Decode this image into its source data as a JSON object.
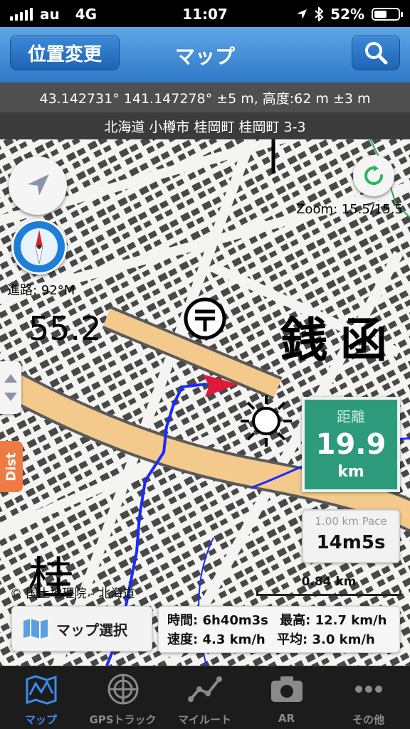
{
  "status_bar": {
    "carrier": "au",
    "network": "4G",
    "time": "11:07",
    "battery": "52%",
    "battery_level": 0.52,
    "icons": [
      "signal-icon",
      "location-arrow-icon",
      "bluetooth-icon",
      "battery-icon"
    ]
  },
  "nav": {
    "location_change_label": "位置変更",
    "title": "マップ",
    "search_icon": "search-icon"
  },
  "info": {
    "coordinates": "43.142731° 141.147278° ±5 m, 高度:62 m ±3 m",
    "address": "北海道 小樽市 桂岡町 桂岡町 3-3"
  },
  "map": {
    "zoom_text": "Zoom: 15.5/15.5",
    "heading_text": "進路: 92°M",
    "dist_tab_label": "Dist",
    "map_labels": {
      "elevation": "55.2",
      "place_name": "銭函",
      "place_name_2": "桂"
    },
    "distance": {
      "label": "距離",
      "value": "19.9",
      "unit": "km"
    },
    "pace": {
      "label": "1.00 km Pace",
      "value": "14m5s"
    },
    "scale_label": "0.84 km",
    "credit": "© 国土地理院 - 北海道",
    "map_select_label": "マップ選択",
    "stats": {
      "time": "時間: 6h40m3s",
      "max_speed": "最高: 12.7 km/h",
      "speed": "速度: 4.3 km/h",
      "average": "平均: 3.0 km/h"
    },
    "colors": {
      "road": "#f3c98c",
      "track": "#1a2bff",
      "heading_arrow": "#e0183a",
      "distance_panel": "#2e9a7c"
    }
  },
  "tabs": [
    {
      "label": "マップ",
      "icon": "map-icon",
      "active": true
    },
    {
      "label": "GPSトラック",
      "icon": "radar-icon",
      "active": false
    },
    {
      "label": "マイルート",
      "icon": "route-icon",
      "active": false
    },
    {
      "label": "AR",
      "icon": "camera-icon",
      "active": false
    },
    {
      "label": "その他",
      "icon": "more-icon",
      "active": false
    }
  ]
}
